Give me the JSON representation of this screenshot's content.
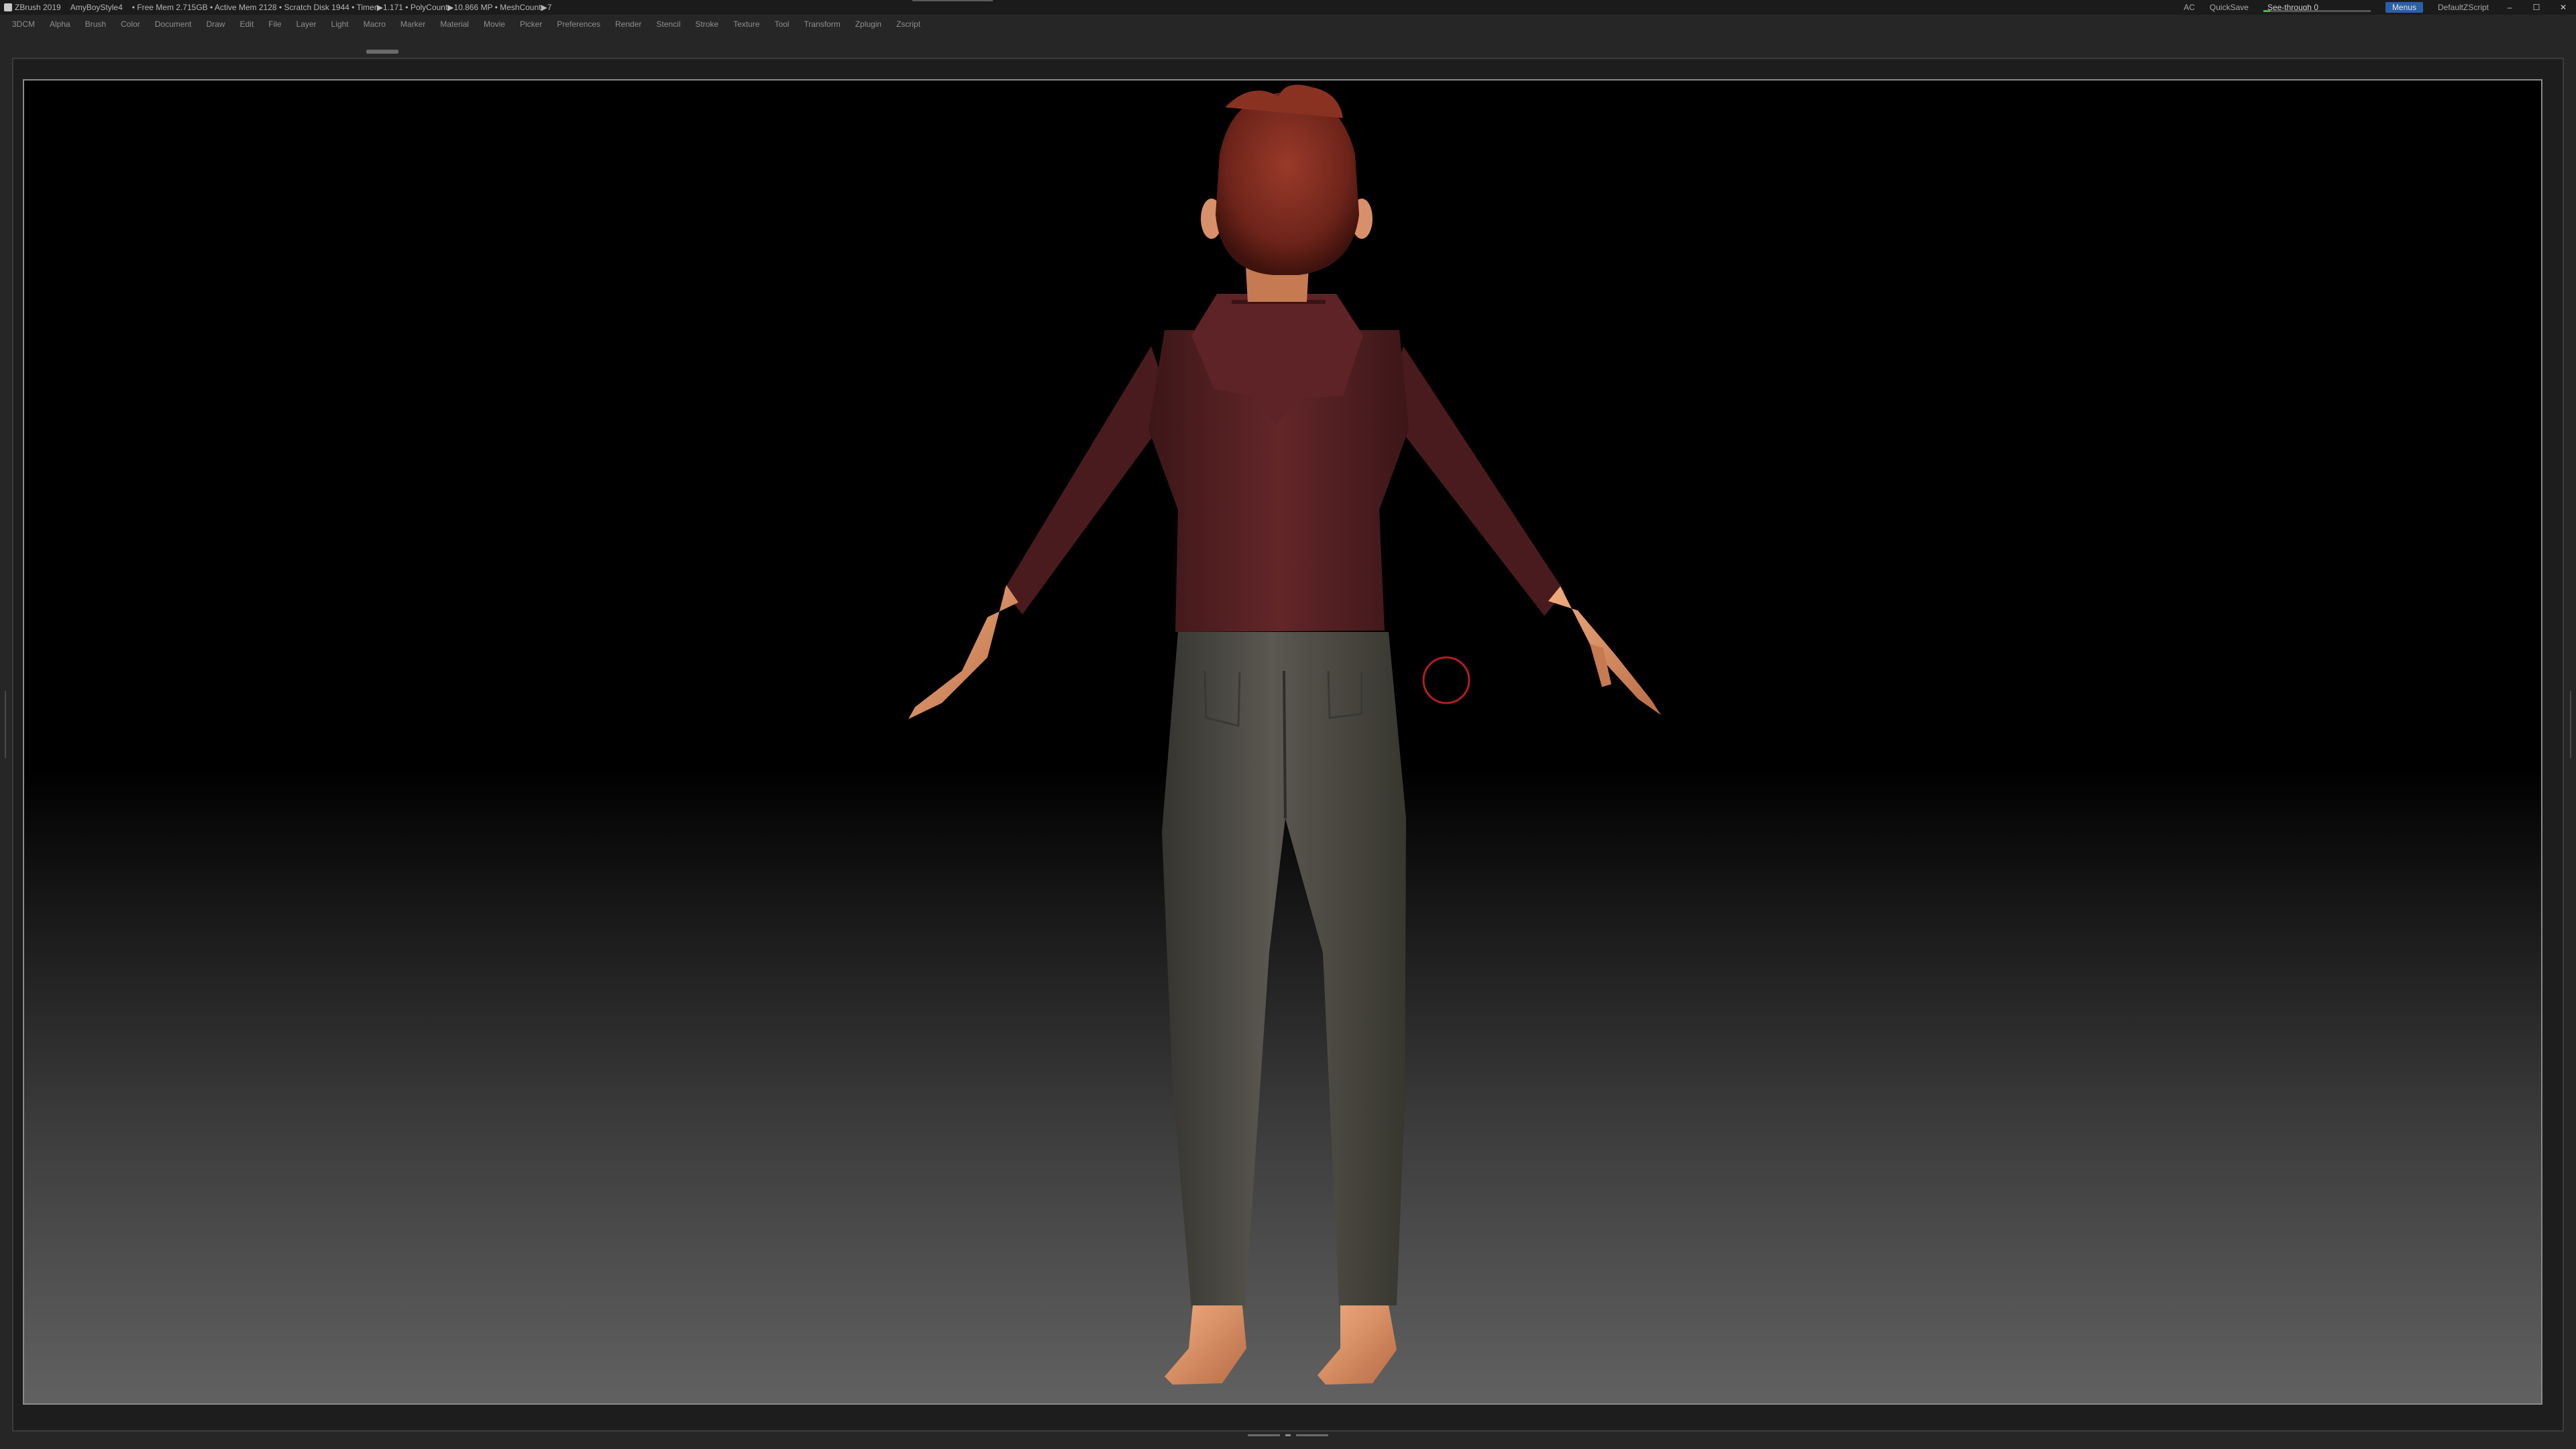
{
  "titlebar": {
    "segments": [
      "ZBrush 2019",
      "AmyBoyStyle4",
      "• Free Mem 2.715GB • Active Mem 2128 • Scratch Disk 1944 • Timer▶1.171 • PolyCount▶10.866 MP • MeshCount▶7"
    ],
    "ac_label": "AC",
    "quicksave_label": "QuickSave",
    "see_through_label": "See-through",
    "see_through_value": "0",
    "menus_label": "Menus",
    "script_label": "DefaultZScript",
    "window_controls": [
      "–",
      "☐",
      "✕"
    ]
  },
  "menubar": {
    "items": [
      "3DCM",
      "Alpha",
      "Brush",
      "Color",
      "Document",
      "Draw",
      "Edit",
      "File",
      "Layer",
      "Light",
      "Macro",
      "Marker",
      "Material",
      "Movie",
      "Picker",
      "Preferences",
      "Render",
      "Stencil",
      "Stroke",
      "Texture",
      "Tool",
      "Transform",
      "Zplugin",
      "Zscript"
    ]
  },
  "colors": {
    "accent": "#2a5fa8",
    "slider_fill": "#4fb34f",
    "hoodie": "#5a2125",
    "pants": "#4f4d45",
    "skin": "#e0976a",
    "hair": "#7a2b20",
    "cursor": "#b0201e"
  },
  "icons": [
    "app-icon",
    "brush-cursor-icon"
  ]
}
